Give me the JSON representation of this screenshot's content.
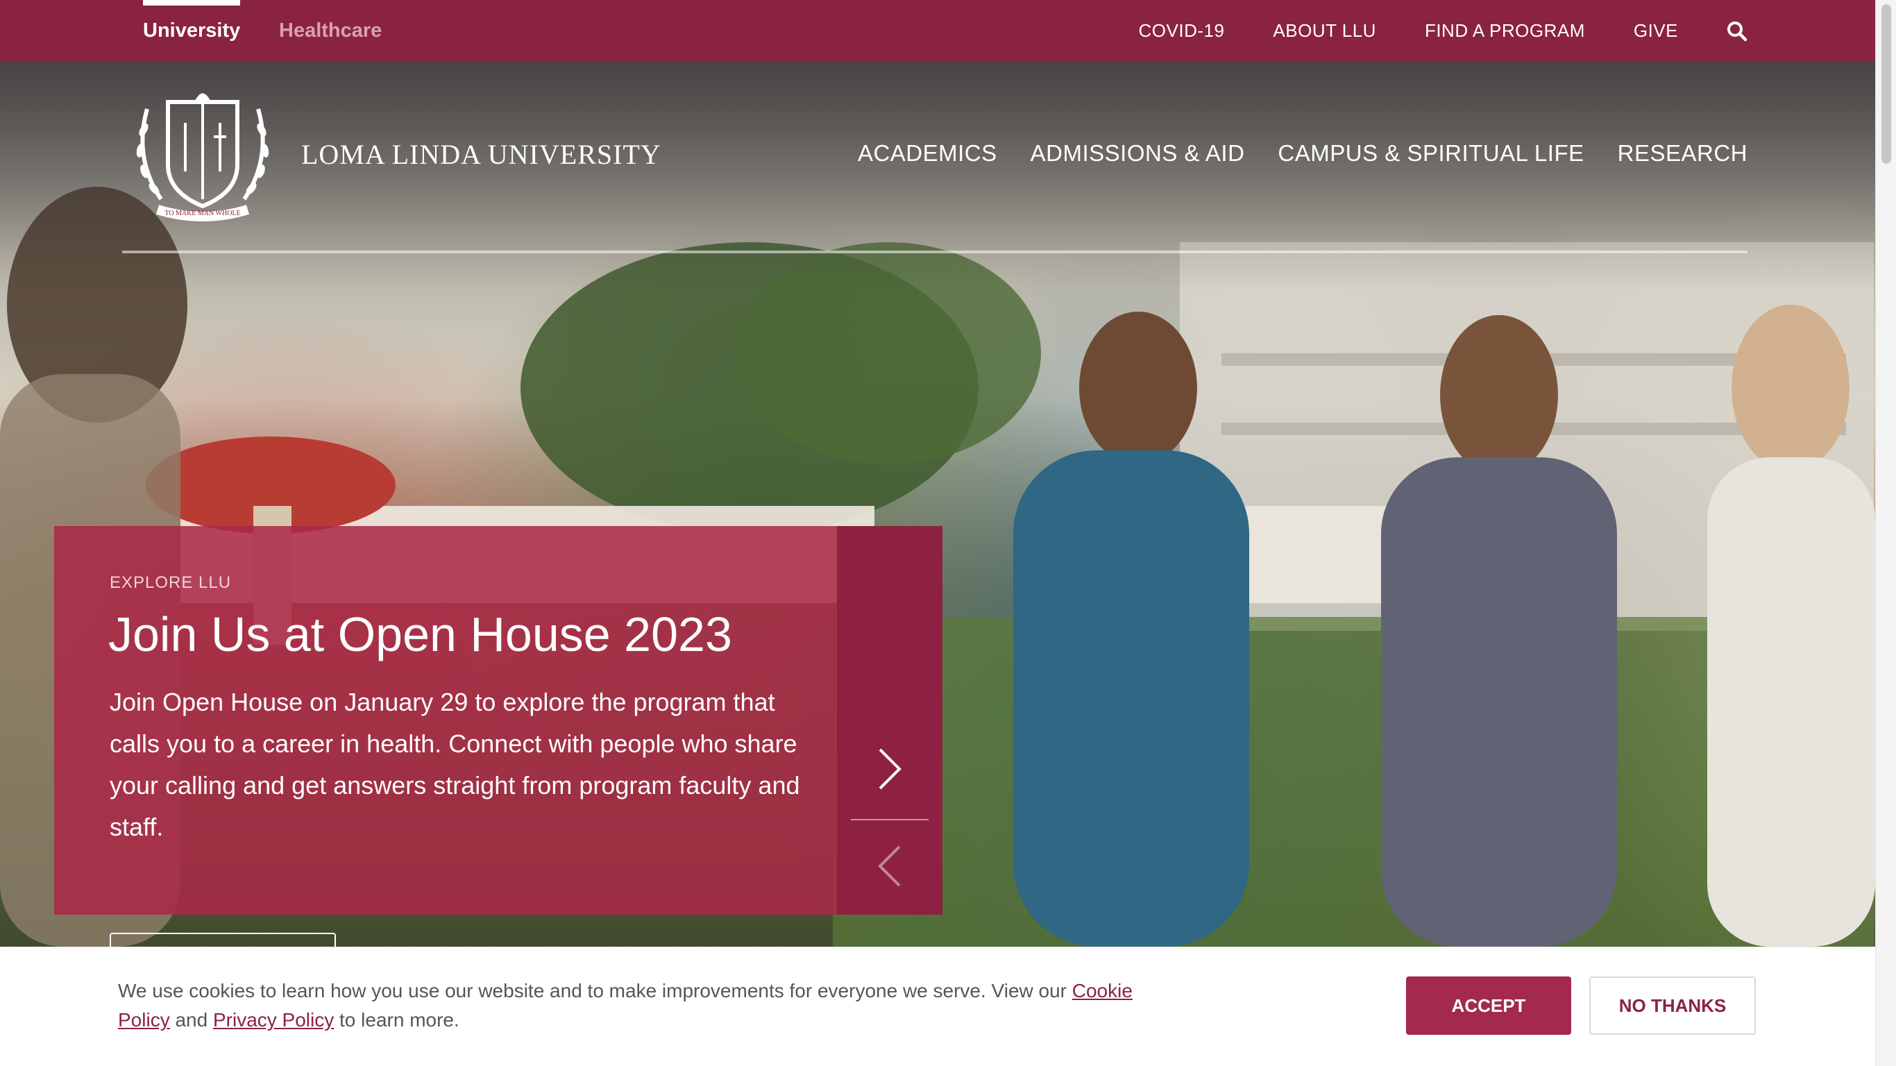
{
  "topbar": {
    "site_tabs": [
      {
        "label": "University",
        "active": true
      },
      {
        "label": "Healthcare",
        "active": false
      }
    ],
    "utility_links": [
      "COVID-19",
      "ABOUT LLU",
      "FIND A PROGRAM",
      "GIVE"
    ],
    "search_icon": "search-icon",
    "bg_color": "#8a2340"
  },
  "header": {
    "logo_motto": "TO MAKE MAN WHOLE",
    "wordmark": "LOMA LINDA UNIVERSITY",
    "main_nav": [
      "ACADEMICS",
      "ADMISSIONS & AID",
      "CAMPUS & SPIRITUAL LIFE",
      "RESEARCH"
    ]
  },
  "slide": {
    "eyebrow": "EXPLORE LLU",
    "title": "Join Us at Open House 2023",
    "body": "Join Open House on January 29 to explore the program that calls you to a career in health. Connect with people who share your calling and get answers straight from program faculty and staff.",
    "next_icon": "chevron-right-icon",
    "prev_icon": "chevron-left-icon",
    "card_color": "#aa2846"
  },
  "cookie_banner": {
    "text_before": "We use cookies to learn how you use our website and to make improvements for everyone we serve. View our ",
    "cookie_policy_link": "Cookie Policy",
    "text_and": " and ",
    "privacy_policy_link": "Privacy Policy",
    "text_after": " to learn more.",
    "accept_label": "ACCEPT",
    "no_thanks_label": "NO THANKS",
    "accent_color": "#a32a4c"
  }
}
